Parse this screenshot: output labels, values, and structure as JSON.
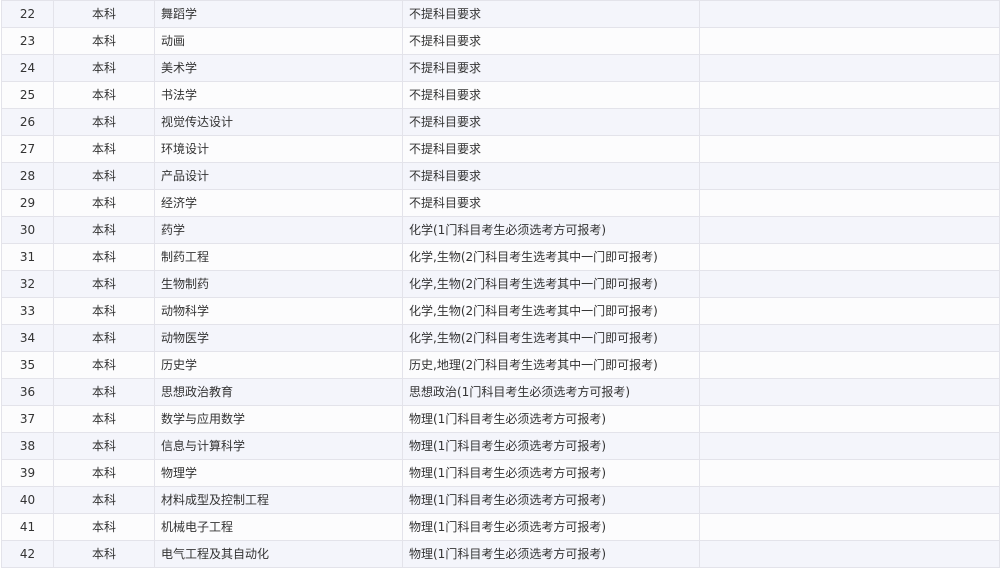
{
  "table": {
    "rows": [
      {
        "idx": "22",
        "level": "本科",
        "major": "舞蹈学",
        "requirement": "不提科目要求"
      },
      {
        "idx": "23",
        "level": "本科",
        "major": "动画",
        "requirement": "不提科目要求"
      },
      {
        "idx": "24",
        "level": "本科",
        "major": "美术学",
        "requirement": "不提科目要求"
      },
      {
        "idx": "25",
        "level": "本科",
        "major": "书法学",
        "requirement": "不提科目要求"
      },
      {
        "idx": "26",
        "level": "本科",
        "major": "视觉传达设计",
        "requirement": "不提科目要求"
      },
      {
        "idx": "27",
        "level": "本科",
        "major": "环境设计",
        "requirement": "不提科目要求"
      },
      {
        "idx": "28",
        "level": "本科",
        "major": "产品设计",
        "requirement": "不提科目要求"
      },
      {
        "idx": "29",
        "level": "本科",
        "major": "经济学",
        "requirement": "不提科目要求"
      },
      {
        "idx": "30",
        "level": "本科",
        "major": "药学",
        "requirement": "化学(1门科目考生必须选考方可报考)"
      },
      {
        "idx": "31",
        "level": "本科",
        "major": "制药工程",
        "requirement": "化学,生物(2门科目考生选考其中一门即可报考)"
      },
      {
        "idx": "32",
        "level": "本科",
        "major": "生物制药",
        "requirement": "化学,生物(2门科目考生选考其中一门即可报考)"
      },
      {
        "idx": "33",
        "level": "本科",
        "major": "动物科学",
        "requirement": "化学,生物(2门科目考生选考其中一门即可报考)"
      },
      {
        "idx": "34",
        "level": "本科",
        "major": "动物医学",
        "requirement": "化学,生物(2门科目考生选考其中一门即可报考)"
      },
      {
        "idx": "35",
        "level": "本科",
        "major": "历史学",
        "requirement": "历史,地理(2门科目考生选考其中一门即可报考)"
      },
      {
        "idx": "36",
        "level": "本科",
        "major": "思想政治教育",
        "requirement": "思想政治(1门科目考生必须选考方可报考)"
      },
      {
        "idx": "37",
        "level": "本科",
        "major": "数学与应用数学",
        "requirement": "物理(1门科目考生必须选考方可报考)"
      },
      {
        "idx": "38",
        "level": "本科",
        "major": "信息与计算科学",
        "requirement": "物理(1门科目考生必须选考方可报考)"
      },
      {
        "idx": "39",
        "level": "本科",
        "major": "物理学",
        "requirement": "物理(1门科目考生必须选考方可报考)"
      },
      {
        "idx": "40",
        "level": "本科",
        "major": "材料成型及控制工程",
        "requirement": "物理(1门科目考生必须选考方可报考)"
      },
      {
        "idx": "41",
        "level": "本科",
        "major": "机械电子工程",
        "requirement": "物理(1门科目考生必须选考方可报考)"
      },
      {
        "idx": "42",
        "level": "本科",
        "major": "电气工程及其自动化",
        "requirement": "物理(1门科目考生必须选考方可报考)"
      }
    ]
  }
}
